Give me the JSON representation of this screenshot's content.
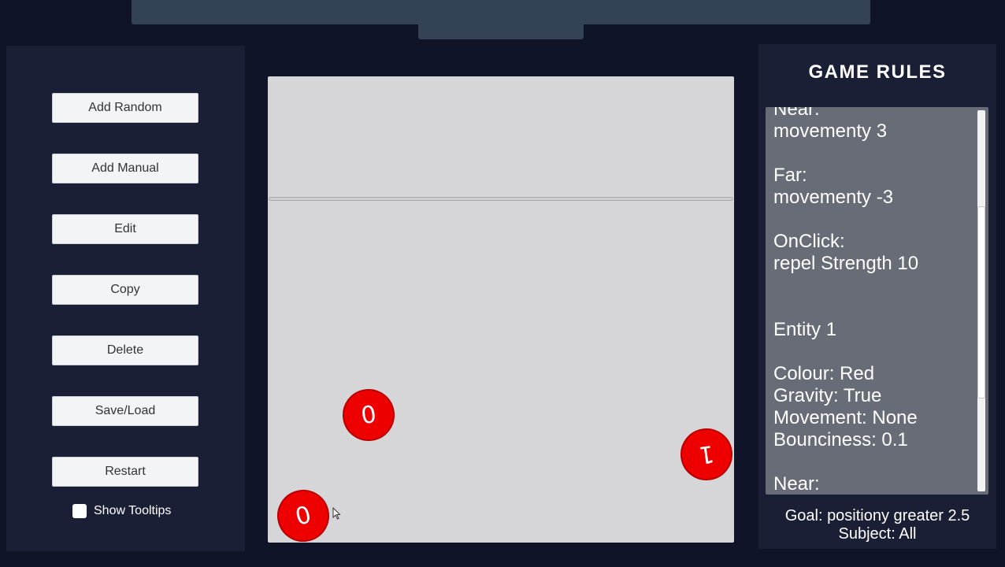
{
  "left_panel": {
    "buttons": [
      {
        "label": "Add Random"
      },
      {
        "label": "Add Manual"
      },
      {
        "label": "Edit"
      },
      {
        "label": "Copy"
      },
      {
        "label": "Delete"
      },
      {
        "label": "Save/Load"
      },
      {
        "label": "Restart"
      }
    ],
    "show_tooltips": {
      "label": "Show Tooltips",
      "checked": false
    }
  },
  "arena": {
    "entities": [
      {
        "label": "0",
        "color": "#ee0000"
      },
      {
        "label": "1",
        "color": "#ee0000"
      },
      {
        "label": "0",
        "color": "#ee0000"
      }
    ]
  },
  "rules": {
    "title": "GAME RULES",
    "text": "Near:\nmovementy 3\n\nFar:\nmovementy -3\n\nOnClick:\nrepel Strength 10\n\n\nEntity 1\n\nColour: Red\nGravity: True\nMovement: None\nBounciness: 0.1\n\nNear:\nmovementy",
    "goal": "Goal: positiony greater 2.5",
    "subject": "Subject: All"
  },
  "colors": {
    "background": "#0f1428",
    "panel": "#1a1f36",
    "arena": "#d6d6d8",
    "entity": "#ee0000"
  }
}
